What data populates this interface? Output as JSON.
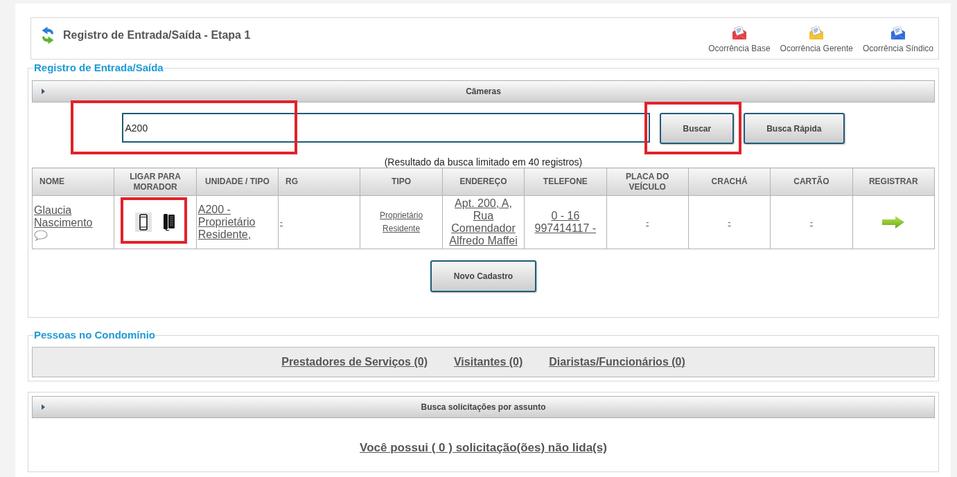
{
  "header": {
    "title": "Registro de Entrada/Saída - Etapa 1",
    "actions": [
      {
        "label": "Ocorrência Base",
        "color": "#e2403f"
      },
      {
        "label": "Ocorrência Gerente",
        "color": "#f2c12e"
      },
      {
        "label": "Ocorrência Síndico",
        "color": "#2f6be0"
      }
    ]
  },
  "entry_section": {
    "legend": "Registro de Entrada/Saída",
    "cameras_panel": {
      "label": "Câmeras",
      "expanded": false
    },
    "search": {
      "value": "A200",
      "highlighted": true
    },
    "buttons": [
      {
        "label": "Buscar",
        "highlighted": true
      },
      {
        "label": "Busca Rápida",
        "highlighted": false
      }
    ],
    "note": "(Resultado da busca limitado em 40 registros)",
    "table": {
      "columns": [
        "NOME",
        "LIGAR PARA MORADOR",
        "UNIDADE / TIPO",
        "RG",
        "TIPO",
        "ENDEREÇO",
        "TELEFONE",
        "PLACA DO VEÍCULO",
        "CRACHÁ",
        "CARTÃO",
        "REGISTRAR"
      ],
      "rows": [
        {
          "cells": [
            {
              "kind": "person",
              "text": "Glaucia Nascimento"
            },
            {
              "kind": "call",
              "highlighted": true
            },
            {
              "kind": "link",
              "text": "A200 - Proprietário Residente,"
            },
            {
              "kind": "small_link",
              "text": "-"
            },
            {
              "kind": "small_link",
              "text": "Proprietário Residente"
            },
            {
              "kind": "link",
              "text": "Apt. 200, A, Rua Comendador Alfredo Maffei"
            },
            {
              "kind": "link",
              "text": "0 - 16 997414117 -"
            },
            {
              "kind": "small_link",
              "text": "-"
            },
            {
              "kind": "small_link",
              "text": "-"
            },
            {
              "kind": "small_link",
              "text": "-"
            },
            {
              "kind": "register"
            }
          ]
        }
      ]
    },
    "new_button": "Novo Cadastro"
  },
  "people_section": {
    "legend": "Pessoas no Condomínio",
    "links": [
      "Prestadores de Serviços (0)",
      "Visitantes (0)",
      "Diaristas/Funcionários (0)"
    ]
  },
  "requests_section": {
    "panel": {
      "label": "Busca solicitações por assunto",
      "expanded": false
    },
    "message": "Você possui ( 0 ) solicitação(ões) não lida(s)"
  }
}
